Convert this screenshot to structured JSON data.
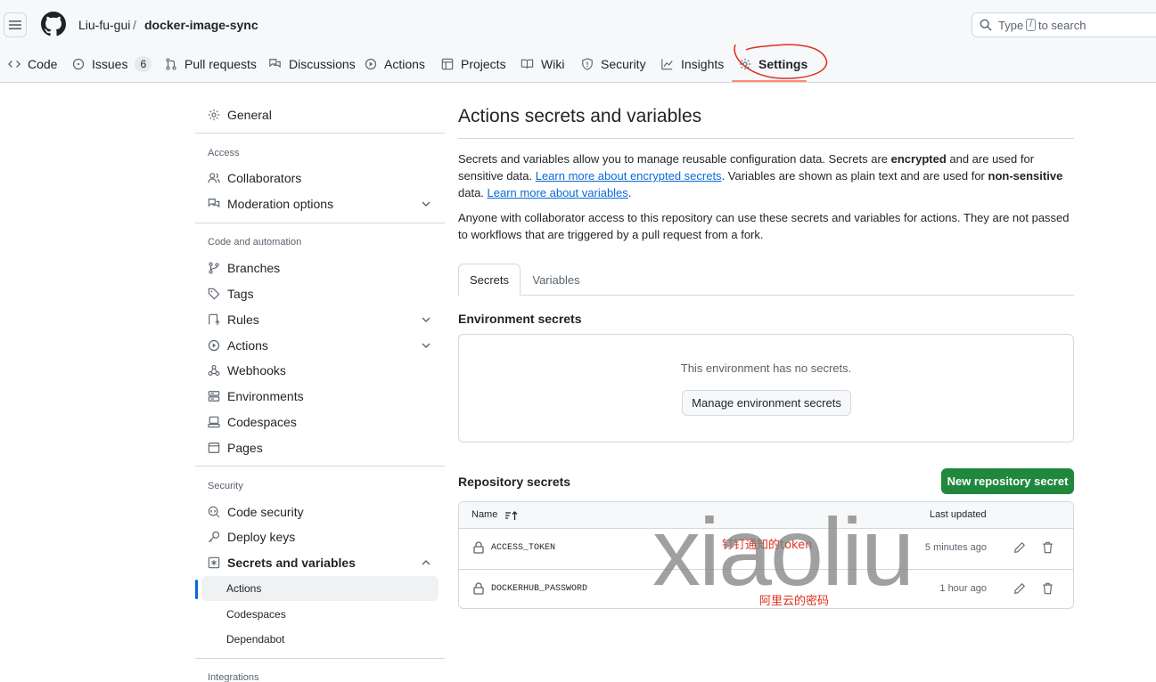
{
  "header": {
    "owner": "Liu-fu-gui",
    "separator": "/",
    "repo": "docker-image-sync",
    "search": {
      "prefix": "Type",
      "key": "/",
      "suffix": "to search"
    }
  },
  "nav": [
    {
      "label": "Code",
      "icon": "code-icon"
    },
    {
      "label": "Issues",
      "icon": "issue-icon",
      "count": "6"
    },
    {
      "label": "Pull requests",
      "icon": "pull-request-icon"
    },
    {
      "label": "Discussions",
      "icon": "discussion-icon"
    },
    {
      "label": "Actions",
      "icon": "play-icon"
    },
    {
      "label": "Projects",
      "icon": "table-icon"
    },
    {
      "label": "Wiki",
      "icon": "book-icon"
    },
    {
      "label": "Security",
      "icon": "shield-icon"
    },
    {
      "label": "Insights",
      "icon": "graph-icon"
    },
    {
      "label": "Settings",
      "icon": "gear-icon",
      "active": true
    }
  ],
  "sidebar": {
    "general": "General",
    "access_head": "Access",
    "collaborators": "Collaborators",
    "moderation": "Moderation options",
    "code_head": "Code and automation",
    "branches": "Branches",
    "tags": "Tags",
    "rules": "Rules",
    "actions": "Actions",
    "webhooks": "Webhooks",
    "environments": "Environments",
    "codespaces": "Codespaces",
    "pages": "Pages",
    "security_head": "Security",
    "code_security": "Code security",
    "deploy_keys": "Deploy keys",
    "secrets_vars": "Secrets and variables",
    "sub_actions": "Actions",
    "sub_codespaces": "Codespaces",
    "sub_dependabot": "Dependabot",
    "integrations_head": "Integrations"
  },
  "main": {
    "title": "Actions secrets and variables",
    "p1_a": "Secrets and variables allow you to manage reusable configuration data. Secrets are ",
    "p1_b": "encrypted",
    "p1_c": " and are used for sensitive data. ",
    "p1_link1": "Learn more about encrypted secrets",
    "p1_d": ". Variables are shown as plain text and are used for ",
    "p1_e": "non-sensitive",
    "p1_f": " data. ",
    "p1_link2": "Learn more about variables",
    "p1_g": ".",
    "p2": "Anyone with collaborator access to this repository can use these secrets and variables for actions. They are not passed to workflows that are triggered by a pull request from a fork.",
    "tab_secrets": "Secrets",
    "tab_variables": "Variables",
    "env_title": "Environment secrets",
    "env_empty": "This environment has no secrets.",
    "env_button": "Manage environment secrets",
    "repo_title": "Repository secrets",
    "new_button": "New repository secret",
    "col_name": "Name",
    "col_updated": "Last updated",
    "rows": [
      {
        "name": "ACCESS_TOKEN",
        "updated": "5 minutes ago"
      },
      {
        "name": "DOCKERHUB_PASSWORD",
        "updated": "1 hour ago"
      }
    ]
  },
  "annotations": {
    "row1_note": "钉钉通知的token",
    "row2_note": "阿里云的密码",
    "watermark": "xiaoliu"
  }
}
